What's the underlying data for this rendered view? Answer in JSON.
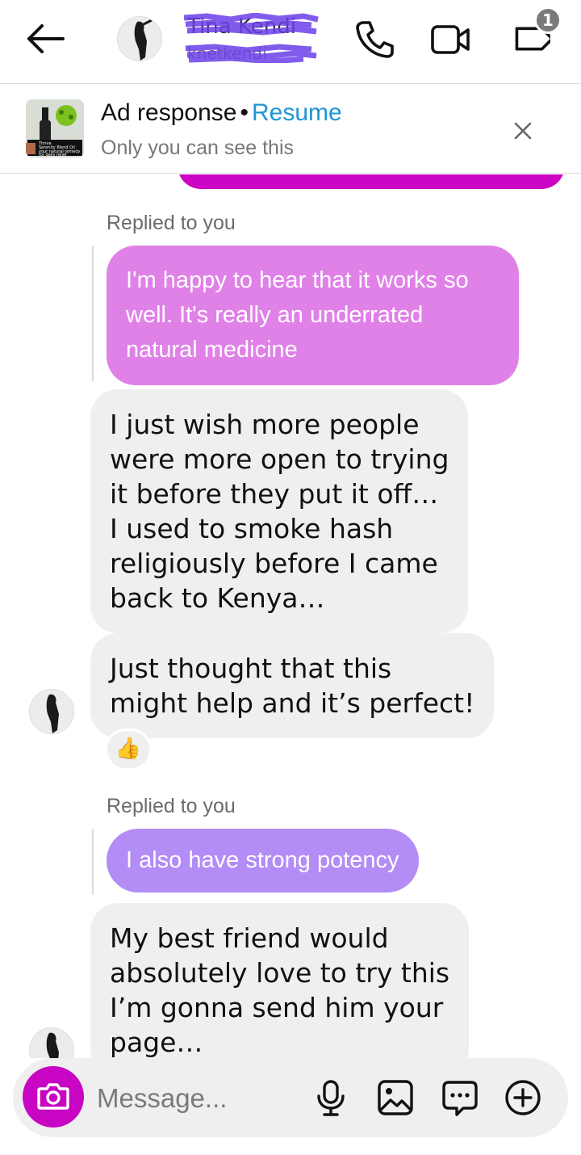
{
  "header": {
    "contact_name": "Tina Kendi",
    "contact_username": "knetkendi"
  },
  "notifications": {
    "badge_count": "1"
  },
  "ad_banner": {
    "title": "Ad response",
    "separator": "•",
    "resume_label": "Resume",
    "subtitle": "Only you can see this",
    "thumb_caption": [
      "Thrive",
      "Serenity Blend Oil",
      "your natural remedy",
      "for daily relief"
    ]
  },
  "conversation": {
    "reply_1": {
      "label": "Replied to you",
      "quoted_text": "I'm happy to hear that it works so well. It's really an underrated natural medicine"
    },
    "message_1": {
      "lines": [
        "I just wish more people",
        "were more open to trying",
        "it before they put it off…",
        "I used to smoke hash",
        "religiously before I came",
        "back to Kenya…"
      ]
    },
    "message_2": {
      "lines": [
        "Just thought that this",
        "might help and it’s perfect!"
      ],
      "reaction": "👍"
    },
    "reply_2": {
      "label": "Replied to you",
      "quoted_text": "I also have strong potency"
    },
    "message_3": {
      "lines": [
        "My best friend would",
        "absolutely love to try this",
        "I’m gonna send him your",
        "page…"
      ]
    }
  },
  "composer": {
    "placeholder": "Message..."
  },
  "colors": {
    "own_bubble": "#cc05c4",
    "quoted_pink": "#e081e8",
    "quoted_purple": "#b38cf6",
    "incoming_bubble": "#efefef",
    "resume_link": "#1f95d6",
    "camera_button": "#c705c3"
  },
  "icons": [
    "back-arrow-icon",
    "phone-icon",
    "video-camera-icon",
    "tag-icon",
    "close-icon",
    "camera-icon",
    "microphone-icon",
    "gallery-icon",
    "sticker-icon",
    "plus-icon"
  ]
}
